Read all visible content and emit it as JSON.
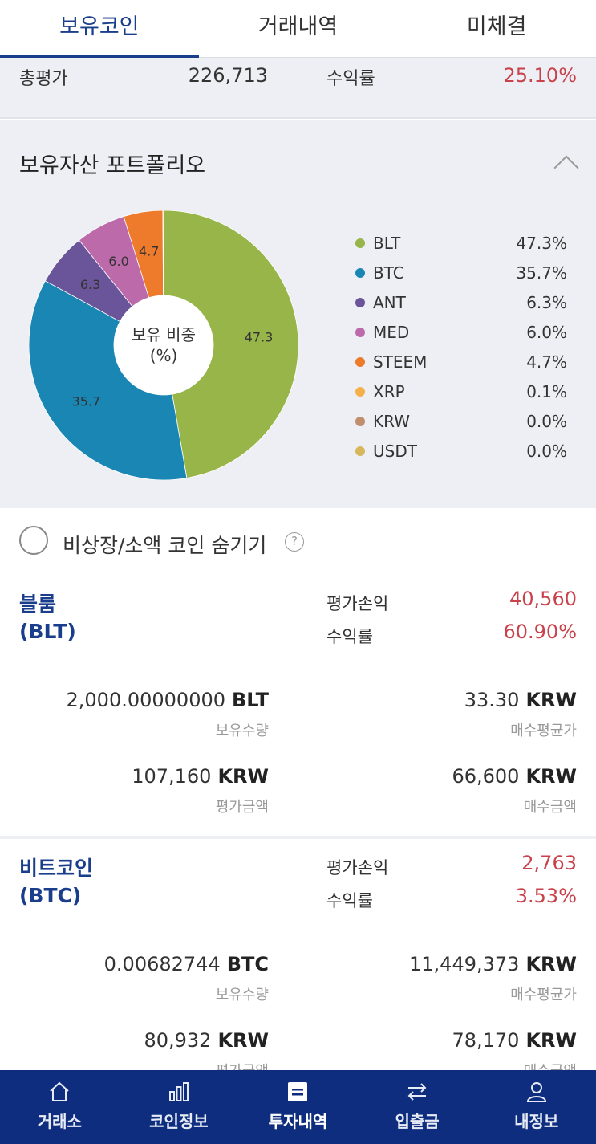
{
  "tabs": [
    "보유코인",
    "거래내역",
    "미체결"
  ],
  "summary": {
    "total_label": "총평가",
    "total_value": "226,713",
    "rate_label": "수익률",
    "rate_value": "25.10%"
  },
  "portfolio": {
    "title": "보유자산 포트폴리오",
    "center_line1": "보유 비중",
    "center_line2": "(%)",
    "slice_labels": [
      "47.3",
      "35.7",
      "6.3",
      "6.0",
      "4.7"
    ],
    "legend": [
      {
        "name": "BLT",
        "value": "47.3%",
        "color": "#97b548"
      },
      {
        "name": "BTC",
        "value": "35.7%",
        "color": "#1a86b4"
      },
      {
        "name": "ANT",
        "value": "6.3%",
        "color": "#6b559a"
      },
      {
        "name": "MED",
        "value": "6.0%",
        "color": "#bd6aaa"
      },
      {
        "name": "STEEM",
        "value": "4.7%",
        "color": "#ee7a2b"
      },
      {
        "name": "XRP",
        "value": "0.1%",
        "color": "#f6b04a"
      },
      {
        "name": "KRW",
        "value": "0.0%",
        "color": "#c08e6c"
      },
      {
        "name": "USDT",
        "value": "0.0%",
        "color": "#d7b75a"
      }
    ]
  },
  "chart_data": {
    "type": "pie",
    "categories": [
      "BLT",
      "BTC",
      "ANT",
      "MED",
      "STEEM",
      "XRP",
      "KRW",
      "USDT"
    ],
    "values": [
      47.3,
      35.7,
      6.3,
      6.0,
      4.7,
      0.1,
      0.0,
      0.0
    ]
  },
  "hide_toggle": {
    "label": "비상장/소액 코인 숨기기",
    "help": "?"
  },
  "coins": [
    {
      "name": "블룸",
      "symbol": "(BLT)",
      "pl_label": "평가손익",
      "pl_value": "40,560",
      "rate_label": "수익률",
      "rate_value": "60.90%",
      "holding_value": "2,000.00000000",
      "holding_unit": "BLT",
      "holding_label": "보유수량",
      "avg_value": "33.30",
      "avg_unit": "KRW",
      "avg_label": "매수평균가",
      "eval_value": "107,160",
      "eval_unit": "KRW",
      "eval_label": "평가금액",
      "buy_value": "66,600",
      "buy_unit": "KRW",
      "buy_label": "매수금액"
    },
    {
      "name": "비트코인",
      "symbol": "(BTC)",
      "pl_label": "평가손익",
      "pl_value": "2,763",
      "rate_label": "수익률",
      "rate_value": "3.53%",
      "holding_value": "0.00682744",
      "holding_unit": "BTC",
      "holding_label": "보유수량",
      "avg_value": "11,449,373",
      "avg_unit": "KRW",
      "avg_label": "매수평균가",
      "eval_value": "80,932",
      "eval_unit": "KRW",
      "eval_label": "평가금액",
      "buy_value": "78,170",
      "buy_unit": "KRW",
      "buy_label": "매수금액"
    }
  ],
  "nav": [
    {
      "label": "거래소",
      "icon": "home-icon"
    },
    {
      "label": "코인정보",
      "icon": "bar-chart-icon"
    },
    {
      "label": "투자내역",
      "icon": "list-icon"
    },
    {
      "label": "입출금",
      "icon": "transfer-icon"
    },
    {
      "label": "내정보",
      "icon": "user-icon"
    }
  ]
}
